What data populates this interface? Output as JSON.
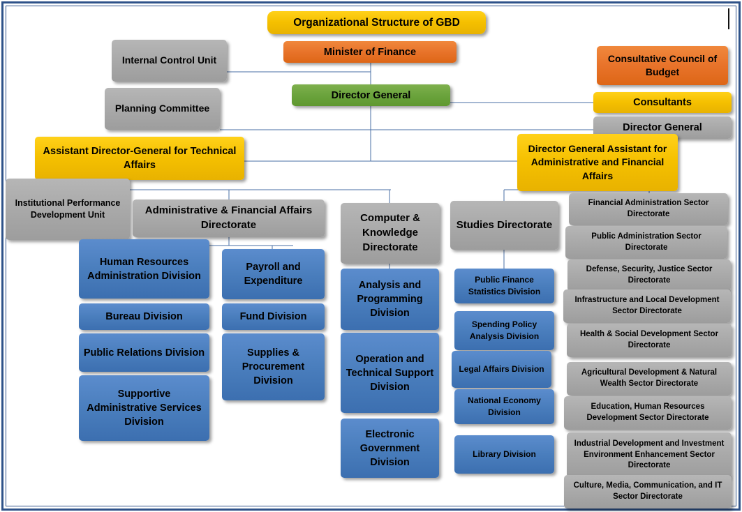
{
  "chart_title": "Organizational Structure of GBD",
  "colors": {
    "gold": "#f5c000",
    "orange": "#e8732a",
    "green": "#6aa33c",
    "gray": "#a9a9a9",
    "blue": "#4a7ebd",
    "border": "#2e5289",
    "connector": "#4a6fa5"
  },
  "nodes": {
    "title": "Organizational Structure of GBD",
    "minister": "Minister of Finance",
    "director_general": "Director General",
    "internal_control": "Internal Control Unit",
    "planning_committee": "Planning Committee",
    "consultative_council": "Consultative Council of Budget",
    "consultants": "Consultants",
    "director_general_right": "Director General",
    "assistant_technical": "Assistant Director-General for Technical Affairs",
    "assistant_admin": "Director General Assistant for Administrative and Financial Affairs",
    "institutional_unit": "Institutional Performance Development Unit",
    "admin_finance_dir": "Administrative & Financial Affairs Directorate",
    "computer_dir": "Computer & Knowledge Directorate",
    "studies_dir": "Studies Directorate"
  },
  "admin_divisions_col1": [
    "Human Resources Administration Division",
    "Bureau Division",
    "Public Relations Division",
    "Supportive Administrative Services Division"
  ],
  "admin_divisions_col2": [
    "Payroll and Expenditure",
    "Fund Division",
    "Supplies & Procurement Division"
  ],
  "computer_divisions": [
    "Analysis and Programming Division",
    "Operation and Technical Support Division",
    "Electronic Government Division"
  ],
  "studies_divisions": [
    "Public Finance Statistics Division",
    "Spending Policy Analysis Division",
    "Legal Affairs Division",
    "National Economy Division",
    "Library Division"
  ],
  "sector_directorates": [
    "Financial Administration Sector Directorate",
    "Public Administration Sector Directorate",
    "Defense, Security, Justice Sector Directorate",
    "Infrastructure and Local Development Sector Directorate",
    "Health & Social Development Sector Directorate",
    "Agricultural Development & Natural Wealth Sector Directorate",
    "Education, Human Resources Development Sector Directorate",
    "Industrial Development and Investment Environment Enhancement Sector Directorate",
    "Culture, Media, Communication, and IT Sector Directorate"
  ]
}
